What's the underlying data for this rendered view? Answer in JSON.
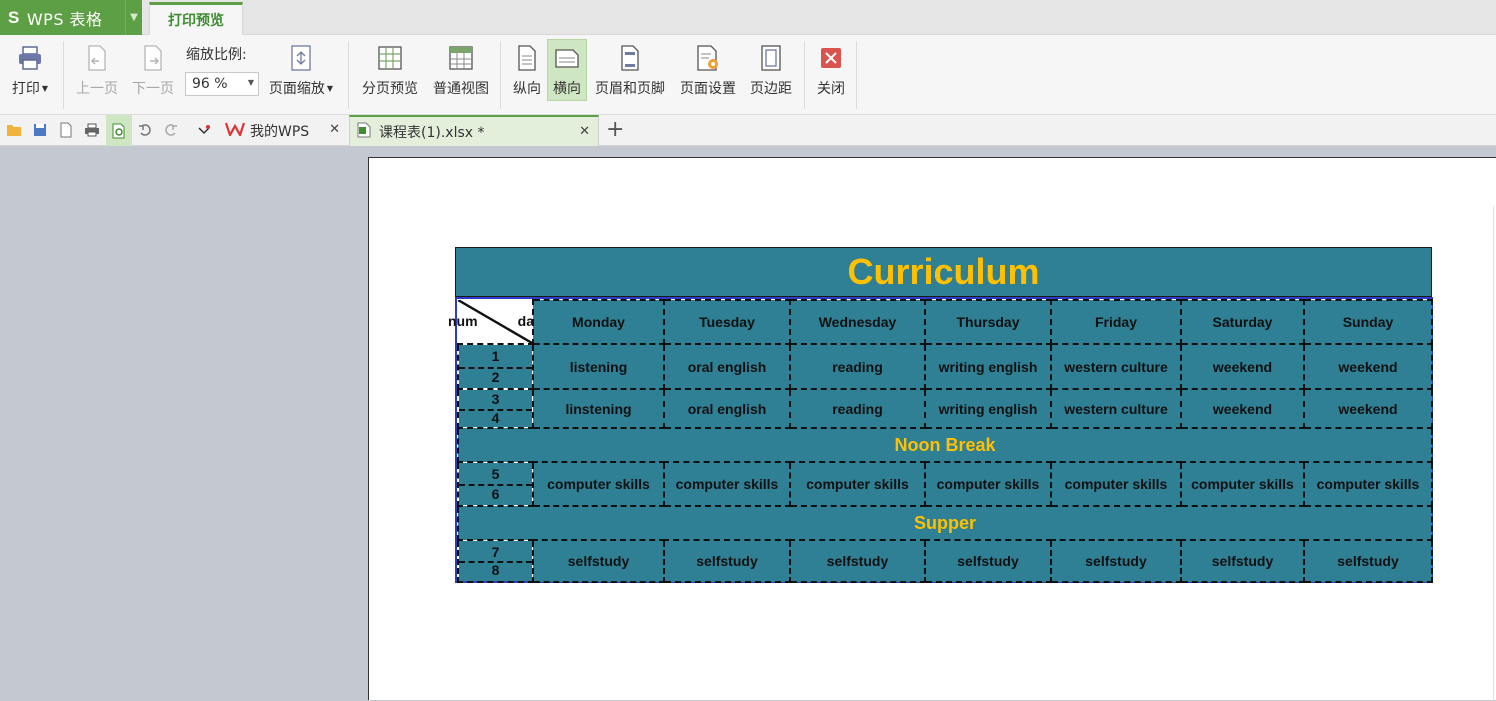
{
  "titlebar": {
    "app_name": "WPS 表格",
    "app_logo_letter": "S",
    "active_tab": "打印预览"
  },
  "ribbon": {
    "print": "打印",
    "prev_page": "上一页",
    "next_page": "下一页",
    "zoom_label": "缩放比例:",
    "zoom_value": "96 %",
    "page_zoom": "页面缩放",
    "page_break_preview": "分页预览",
    "normal_view": "普通视图",
    "portrait": "纵向",
    "landscape": "横向",
    "header_footer": "页眉和页脚",
    "page_setup": "页面设置",
    "margins": "页边距",
    "close": "关闭"
  },
  "doc_tabs": [
    {
      "label": "我的WPS",
      "active": false
    },
    {
      "label": "课程表(1).xlsx *",
      "active": true
    }
  ],
  "sheet": {
    "title": "Curriculum",
    "corner_left": "num",
    "corner_right": "da",
    "days": [
      "Monday",
      "Tuesday",
      "Wednesday",
      "Thursday",
      "Friday",
      "Saturday",
      "Sunday"
    ],
    "rows": [
      {
        "n1": "1",
        "n2": "2",
        "cells": [
          "listening",
          "oral english",
          "reading",
          "writing english",
          "western culture",
          "weekend",
          "weekend"
        ]
      },
      {
        "n1": "3",
        "n2": "4",
        "cells": [
          "linstening",
          "oral english",
          "reading",
          "writing english",
          "western culture",
          "weekend",
          "weekend"
        ]
      },
      {
        "band": "Noon Break"
      },
      {
        "n1": "5",
        "n2": "6",
        "cells": [
          "computer skills",
          "computer skills",
          "computer skills",
          "computer skills",
          "computer skills",
          "computer skills",
          "computer skills"
        ]
      },
      {
        "band": "Supper"
      },
      {
        "n1": "7",
        "n2": "8",
        "cells": [
          "selfstudy",
          "selfstudy",
          "selfstudy",
          "selfstudy",
          "selfstudy",
          "selfstudy",
          "selfstudy"
        ]
      }
    ]
  },
  "colors": {
    "brand": "#5d9f44",
    "cell_fill": "#2f7f95",
    "title_text": "#ffc000",
    "grid_border": "#2a3cc8"
  },
  "icons": [
    "printer-icon",
    "prev-page-icon",
    "next-page-icon",
    "page-zoom-icon",
    "page-break-preview-icon",
    "normal-view-icon",
    "portrait-icon",
    "landscape-icon",
    "header-footer-icon",
    "page-setup-icon",
    "margins-icon",
    "close-icon"
  ]
}
